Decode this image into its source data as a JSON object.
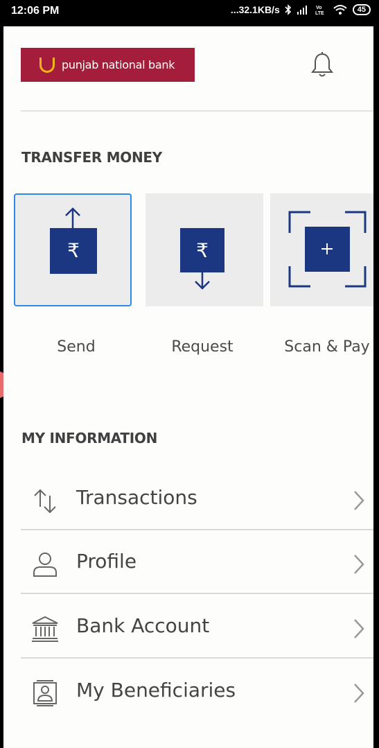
{
  "status_bar": {
    "time": "12:06 PM",
    "network_speed": "...32.1KB/s",
    "battery": "45",
    "icons": [
      "bluetooth-icon",
      "signal-icon",
      "volte-icon",
      "wifi-icon",
      "battery-icon"
    ]
  },
  "header": {
    "logo_text": "punjab national bank",
    "bell_icon": "bell-icon"
  },
  "transfer_money": {
    "title": "TRANSFER MONEY",
    "tiles": [
      {
        "label": "Send",
        "icon": "send-money-icon"
      },
      {
        "label": "Request",
        "icon": "request-money-icon"
      },
      {
        "label": "Scan & Pay",
        "icon": "scan-pay-icon"
      }
    ]
  },
  "my_information": {
    "title": "MY INFORMATION",
    "items": [
      {
        "label": "Transactions",
        "icon": "transactions-icon"
      },
      {
        "label": "Profile",
        "icon": "profile-icon"
      },
      {
        "label": "Bank Account",
        "icon": "bank-icon"
      },
      {
        "label": "My Beneficiaries",
        "icon": "beneficiaries-icon"
      }
    ]
  },
  "colors": {
    "brand": "#a41e3b",
    "accent_yellow": "#f5b518",
    "tile_icon": "#1c3781",
    "selected_border": "#2e88e6"
  }
}
